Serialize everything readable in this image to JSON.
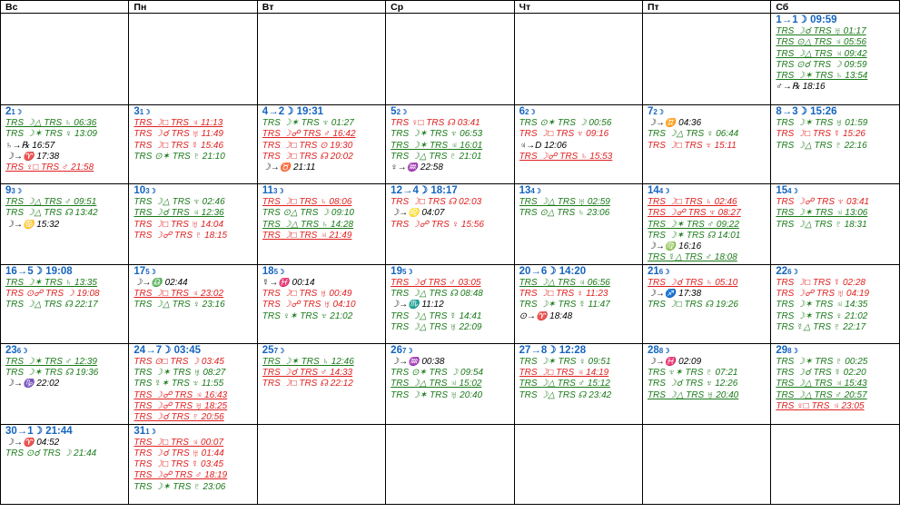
{
  "weekdays": [
    "Вс",
    "Пн",
    "Вт",
    "Ср",
    "Чт",
    "Пт",
    "Сб"
  ],
  "weeks": [
    [
      null,
      null,
      null,
      null,
      null,
      null,
      {
        "day": "1",
        "phase": "→1☽ 09:59",
        "events": [
          {
            "t": "TRS ☽☌ TRS ♅ 01:17",
            "c": "g",
            "u": true
          },
          {
            "t": "TRS ⊙△ TRS ♃ 05:56",
            "c": "g",
            "u": true
          },
          {
            "t": "TRS ☽△ TRS ♃ 09:42",
            "c": "g",
            "u": true
          },
          {
            "t": "TRS ⊙☌ TRS ☽ 09:59",
            "c": "g",
            "u": false
          },
          {
            "t": "TRS ☽✶ TRS ♄ 13:54",
            "c": "g",
            "u": true
          },
          {
            "t": "♂→℞ 18:16",
            "c": "k",
            "u": false
          }
        ]
      }
    ],
    [
      {
        "day": "2",
        "phase": "1☽",
        "events": [
          {
            "t": "TRS ☽△ TRS ♄ 06:36",
            "c": "g",
            "u": true
          },
          {
            "t": "TRS ☽✶ TRS ♀ 13:09",
            "c": "g",
            "u": false
          },
          {
            "t": "♄→℞ 16:57",
            "c": "k",
            "u": false
          },
          {
            "t": "☽→♈ 17:38",
            "c": "k",
            "u": false
          },
          {
            "t": "TRS ♀□ TRS ♂ 21:58",
            "c": "r",
            "u": true
          }
        ]
      },
      {
        "day": "3",
        "phase": "1☽",
        "events": [
          {
            "t": "TRS ☽□ TRS ♃ 11:13",
            "c": "r",
            "u": true
          },
          {
            "t": "TRS ☽☌ TRS ♅ 11:49",
            "c": "r",
            "u": false
          },
          {
            "t": "TRS ☽□ TRS ☿ 15:46",
            "c": "r",
            "u": false
          },
          {
            "t": "TRS ⊙✶ TRS ♇ 21:10",
            "c": "g",
            "u": false
          }
        ]
      },
      {
        "day": "4",
        "phase": "→2☽ 19:31",
        "events": [
          {
            "t": "TRS ☽✶ TRS ♆ 01:27",
            "c": "g",
            "u": false
          },
          {
            "t": "TRS ☽☍ TRS ♂ 16:42",
            "c": "r",
            "u": true
          },
          {
            "t": "TRS ☽□ TRS ⊙ 19:30",
            "c": "r",
            "u": false
          },
          {
            "t": "TRS ☽□ TRS ☊ 20:02",
            "c": "r",
            "u": false
          },
          {
            "t": "☽→♉ 21:11",
            "c": "k",
            "u": false
          }
        ]
      },
      {
        "day": "5",
        "phase": "2☽",
        "events": [
          {
            "t": "TRS ♀□ TRS ☊ 03:41",
            "c": "r",
            "u": false
          },
          {
            "t": "TRS ☽✶ TRS ♆ 06:53",
            "c": "g",
            "u": false
          },
          {
            "t": "TRS ☽✶ TRS ♃ 16:01",
            "c": "g",
            "u": true
          },
          {
            "t": "TRS ☽△ TRS ♇ 21:01",
            "c": "g",
            "u": false
          },
          {
            "t": "♀→♒ 22:58",
            "c": "k",
            "u": false
          }
        ]
      },
      {
        "day": "6",
        "phase": "2☽",
        "events": [
          {
            "t": "TRS ⊙✶ TRS ☽ 00:56",
            "c": "g",
            "u": false
          },
          {
            "t": "TRS ☽□ TRS ♆ 09:16",
            "c": "r",
            "u": false
          },
          {
            "t": "♃→D 12:06",
            "c": "k",
            "u": false
          },
          {
            "t": "TRS ☽☍ TRS ♄ 15:53",
            "c": "r",
            "u": true
          }
        ]
      },
      {
        "day": "7",
        "phase": "2☽",
        "events": [
          {
            "t": "☽→♊ 04:36",
            "c": "k",
            "u": false
          },
          {
            "t": "TRS ☽△ TRS ♀ 06:44",
            "c": "g",
            "u": false
          },
          {
            "t": "TRS ☽□ TRS ♆ 15:11",
            "c": "r",
            "u": false
          }
        ]
      },
      {
        "day": "8",
        "phase": "→3☽ 15:26",
        "events": [
          {
            "t": "TRS ☽✶ TRS ♅ 01:59",
            "c": "g",
            "u": false
          },
          {
            "t": "TRS ☽□ TRS ☿ 15:26",
            "c": "r",
            "u": false
          },
          {
            "t": "TRS ☽△ TRS ♇ 22:16",
            "c": "g",
            "u": false
          }
        ]
      }
    ],
    [
      {
        "day": "9",
        "phase": "3☽",
        "events": [
          {
            "t": "TRS ☽△ TRS ♂ 09:51",
            "c": "g",
            "u": true
          },
          {
            "t": "TRS ☽△ TRS ☊ 13:42",
            "c": "g",
            "u": false
          },
          {
            "t": "☽→♋ 15:32",
            "c": "k",
            "u": false
          }
        ]
      },
      {
        "day": "10",
        "phase": "3☽",
        "events": [
          {
            "t": "TRS ☽△ TRS ♆ 02:46",
            "c": "g",
            "u": false
          },
          {
            "t": "TRS ☽☌ TRS ♃ 12:36",
            "c": "g",
            "u": true
          },
          {
            "t": "TRS ☽□ TRS ♅ 14:04",
            "c": "r",
            "u": false
          },
          {
            "t": "TRS ☽☍ TRS ♇ 18:15",
            "c": "r",
            "u": false
          }
        ]
      },
      {
        "day": "11",
        "phase": "3☽",
        "events": [
          {
            "t": "TRS ☽□ TRS ♄ 08:06",
            "c": "r",
            "u": true
          },
          {
            "t": "TRS ⊙△ TRS ☽ 09:10",
            "c": "g",
            "u": false
          },
          {
            "t": "TRS ☽△ TRS ♄ 14:28",
            "c": "g",
            "u": true
          },
          {
            "t": "TRS ☽□ TRS ♃ 21:49",
            "c": "r",
            "u": true
          }
        ]
      },
      {
        "day": "12",
        "phase": "→4☽ 18:17",
        "events": [
          {
            "t": "TRS ☽□ TRS ☊ 02:03",
            "c": "r",
            "u": false
          },
          {
            "t": "☽→♌ 04:07",
            "c": "k",
            "u": false
          },
          {
            "t": "TRS ☽☍ TRS ♀ 15:56",
            "c": "r",
            "u": false
          }
        ]
      },
      {
        "day": "13",
        "phase": "4☽",
        "events": [
          {
            "t": "TRS ☽△ TRS ♅ 02:59",
            "c": "g",
            "u": true
          },
          {
            "t": "TRS ⊙△ TRS ♄ 23:06",
            "c": "g",
            "u": false
          }
        ]
      },
      {
        "day": "14",
        "phase": "4☽",
        "events": [
          {
            "t": "TRS ☽□ TRS ♄ 02:46",
            "c": "r",
            "u": true
          },
          {
            "t": "TRS ☽☍ TRS ♆ 08:27",
            "c": "r",
            "u": true
          },
          {
            "t": "TRS ☽✶ TRS ♂ 09:22",
            "c": "g",
            "u": true
          },
          {
            "t": "TRS ☽✶ TRS ☊ 14:01",
            "c": "g",
            "u": false
          },
          {
            "t": "☽→♍ 16:16",
            "c": "k",
            "u": false
          },
          {
            "t": "TRS ☿△ TRS ♂ 18:08",
            "c": "g",
            "u": true
          }
        ]
      },
      {
        "day": "15",
        "phase": "4☽",
        "events": [
          {
            "t": "TRS ☽☍ TRS ♆ 03:41",
            "c": "r",
            "u": false
          },
          {
            "t": "TRS ☽✶ TRS ♃ 13:06",
            "c": "g",
            "u": true
          },
          {
            "t": "TRS ☽△ TRS ♇ 18:31",
            "c": "g",
            "u": false
          }
        ]
      }
    ],
    [
      {
        "day": "16",
        "phase": "→5☽ 19:08",
        "events": [
          {
            "t": "TRS ☽✶ TRS ♄ 13:35",
            "c": "g",
            "u": true
          },
          {
            "t": "TRS ⊙☍ TRS ☽ 19:08",
            "c": "r",
            "u": false
          },
          {
            "t": "TRS ☽△ TRS ☊ 22:17",
            "c": "g",
            "u": false
          }
        ]
      },
      {
        "day": "17",
        "phase": "5☽",
        "events": [
          {
            "t": "☽→♎ 02:44",
            "c": "k",
            "u": false
          },
          {
            "t": "TRS ☽□ TRS ♃ 23:02",
            "c": "r",
            "u": true
          },
          {
            "t": "TRS ☽△ TRS ♀ 23:16",
            "c": "g",
            "u": false
          }
        ]
      },
      {
        "day": "18",
        "phase": "5☽",
        "events": [
          {
            "t": "☿→♓ 00:14",
            "c": "k",
            "u": false
          },
          {
            "t": "TRS ☽□ TRS ♅ 00:49",
            "c": "r",
            "u": false
          },
          {
            "t": "TRS ☽☍ TRS ♅ 04:10",
            "c": "r",
            "u": false
          },
          {
            "t": "TRS ♀✶ TRS ♆ 21:02",
            "c": "g",
            "u": false
          }
        ]
      },
      {
        "day": "19",
        "phase": "5☽",
        "events": [
          {
            "t": "TRS ☽☌ TRS ♂ 03:05",
            "c": "r",
            "u": true
          },
          {
            "t": "TRS ☽△ TRS ☊ 08:48",
            "c": "g",
            "u": false
          },
          {
            "t": "☽→♏ 11:12",
            "c": "k",
            "u": false
          },
          {
            "t": "TRS ☽△ TRS ☿ 14:41",
            "c": "g",
            "u": false
          },
          {
            "t": "TRS ☽△ TRS ♅ 22:09",
            "c": "g",
            "u": false
          }
        ]
      },
      {
        "day": "20",
        "phase": "→6☽ 14:20",
        "events": [
          {
            "t": "TRS ☽△ TRS ♃ 06:56",
            "c": "g",
            "u": true
          },
          {
            "t": "TRS ☽□ TRS ♀ 11:23",
            "c": "r",
            "u": false
          },
          {
            "t": "TRS ☽✶ TRS ☿ 11:47",
            "c": "g",
            "u": false
          },
          {
            "t": "⊙→♈ 18:48",
            "c": "k",
            "u": false
          }
        ]
      },
      {
        "day": "21",
        "phase": "6☽",
        "events": [
          {
            "t": "TRS ☽☌ TRS ♄ 05:10",
            "c": "r",
            "u": true
          },
          {
            "t": "☽→♐ 17:38",
            "c": "k",
            "u": false
          },
          {
            "t": "TRS ☽□ TRS ☊ 19:26",
            "c": "g",
            "u": false
          }
        ]
      },
      {
        "day": "22",
        "phase": "6☽",
        "events": [
          {
            "t": "TRS ☽□ TRS ☿ 02:28",
            "c": "r",
            "u": false
          },
          {
            "t": "TRS ☽☍ TRS ♅ 04:19",
            "c": "r",
            "u": false
          },
          {
            "t": "TRS ☽✶ TRS ♃ 14:35",
            "c": "g",
            "u": false
          },
          {
            "t": "TRS ☽✶ TRS ♀ 21:02",
            "c": "g",
            "u": false
          },
          {
            "t": "TRS ☿△ TRS ♇ 22:17",
            "c": "g",
            "u": false
          }
        ]
      }
    ],
    [
      {
        "day": "23",
        "phase": "6☽",
        "events": [
          {
            "t": "TRS ☽✶ TRS ♂ 12:39",
            "c": "g",
            "u": true
          },
          {
            "t": "TRS ☽✶ TRS ☊ 19:36",
            "c": "g",
            "u": false
          },
          {
            "t": "☽→♑ 22:02",
            "c": "k",
            "u": false
          }
        ]
      },
      {
        "day": "24",
        "phase": "→7☽ 03:45",
        "events": [
          {
            "t": "TRS ⊙□ TRS ☽ 03:45",
            "c": "r",
            "u": false
          },
          {
            "t": "TRS ☽✶ TRS ♅ 08:27",
            "c": "g",
            "u": false
          },
          {
            "t": "TRS ☿✶ TRS ♆ 11:55",
            "c": "g",
            "u": false
          },
          {
            "t": "TRS ☽☍ TRS ♃ 16:43",
            "c": "r",
            "u": true
          },
          {
            "t": "TRS ☽☍ TRS ♅ 18:25",
            "c": "r",
            "u": true
          },
          {
            "t": "TRS ☽☌ TRS ♇ 20:56",
            "c": "r",
            "u": true
          }
        ]
      },
      {
        "day": "25",
        "phase": "7☽",
        "events": [
          {
            "t": "TRS ☽✶ TRS ♄ 12:46",
            "c": "g",
            "u": true
          },
          {
            "t": "TRS ☽☌ TRS ♂ 14:33",
            "c": "r",
            "u": true
          },
          {
            "t": "TRS ☽□ TRS ☊ 22:12",
            "c": "r",
            "u": false
          }
        ]
      },
      {
        "day": "26",
        "phase": "7☽",
        "events": [
          {
            "t": "☽→♒ 00:38",
            "c": "k",
            "u": false
          },
          {
            "t": "TRS ⊙✶ TRS ☽ 09:54",
            "c": "g",
            "u": false
          },
          {
            "t": "TRS ☽△ TRS ♃ 15:02",
            "c": "g",
            "u": true
          },
          {
            "t": "TRS ☽✶ TRS ♅ 20:40",
            "c": "g",
            "u": false
          }
        ]
      },
      {
        "day": "27",
        "phase": "→8☽ 12:28",
        "events": [
          {
            "t": "TRS ☽✶ TRS ♀ 09:51",
            "c": "g",
            "u": false
          },
          {
            "t": "TRS ☽□ TRS ♃ 14:19",
            "c": "r",
            "u": true
          },
          {
            "t": "TRS ☽△ TRS ♂ 15:12",
            "c": "g",
            "u": true
          },
          {
            "t": "TRS ☽△ TRS ☊ 23:42",
            "c": "g",
            "u": false
          }
        ]
      },
      {
        "day": "28",
        "phase": "8☽",
        "events": [
          {
            "t": "☽→♓ 02:09",
            "c": "k",
            "u": false
          },
          {
            "t": "TRS ♆✶ TRS ♇ 07:21",
            "c": "g",
            "u": false
          },
          {
            "t": "TRS ☽☌ TRS ♆ 12:26",
            "c": "g",
            "u": false
          },
          {
            "t": "TRS ☽△ TRS ♅ 20:40",
            "c": "g",
            "u": true
          }
        ]
      },
      {
        "day": "29",
        "phase": "8☽",
        "events": [
          {
            "t": "TRS ☽✶ TRS ♇ 00:25",
            "c": "g",
            "u": false
          },
          {
            "t": "TRS ☽☌ TRS ☿ 02:20",
            "c": "g",
            "u": false
          },
          {
            "t": "TRS ☽△ TRS ♃ 15:43",
            "c": "g",
            "u": true
          },
          {
            "t": "TRS ☽△ TRS ♂ 20:57",
            "c": "g",
            "u": true
          },
          {
            "t": "TRS ♀□ TRS ♃ 23:05",
            "c": "r",
            "u": true
          }
        ]
      }
    ],
    [
      {
        "day": "30",
        "phase": "→1☽ 21:44",
        "events": [
          {
            "t": "☽→♈ 04:52",
            "c": "k",
            "u": false
          },
          {
            "t": "TRS ⊙☌ TRS ☽ 21:44",
            "c": "g",
            "u": false
          }
        ]
      },
      {
        "day": "31",
        "phase": "1☽",
        "events": [
          {
            "t": "TRS ☽□ TRS ♃ 00:07",
            "c": "r",
            "u": true
          },
          {
            "t": "TRS ☽☌ TRS ♅ 01:44",
            "c": "r",
            "u": false
          },
          {
            "t": "TRS ☽□ TRS ☿ 03:45",
            "c": "r",
            "u": false
          },
          {
            "t": "TRS ☽☍ TRS ♂ 18:19",
            "c": "r",
            "u": true
          },
          {
            "t": "TRS ☽✶ TRS ♇ 23:06",
            "c": "g",
            "u": false
          }
        ]
      },
      null,
      null,
      null,
      null,
      null
    ]
  ]
}
